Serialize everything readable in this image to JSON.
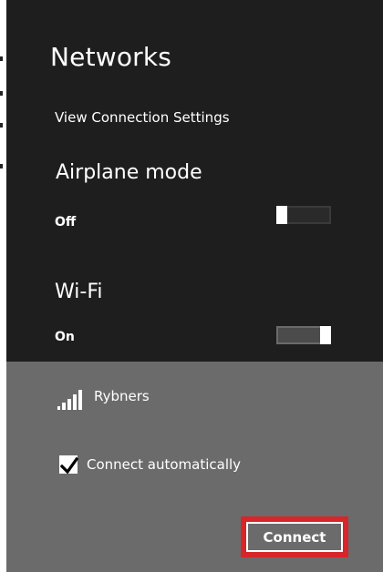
{
  "panel": {
    "title": "Networks",
    "settings_link": "View Connection Settings"
  },
  "airplane_mode": {
    "label": "Airplane mode",
    "state_text": "Off",
    "on": false
  },
  "wifi": {
    "label": "Wi-Fi",
    "state_text": "On",
    "on": true
  },
  "network": {
    "name": "Rybners",
    "icon": "wifi-signal-icon",
    "signal_bars": 5
  },
  "connect_automatically": {
    "label": "Connect automatically",
    "checked": true
  },
  "connect_button": {
    "label": "Connect",
    "highlight_color": "#d7252a"
  },
  "colors": {
    "pane_background": "#1e1e1e",
    "expanded_network_background": "#6b6b6b",
    "text": "#ffffff"
  }
}
